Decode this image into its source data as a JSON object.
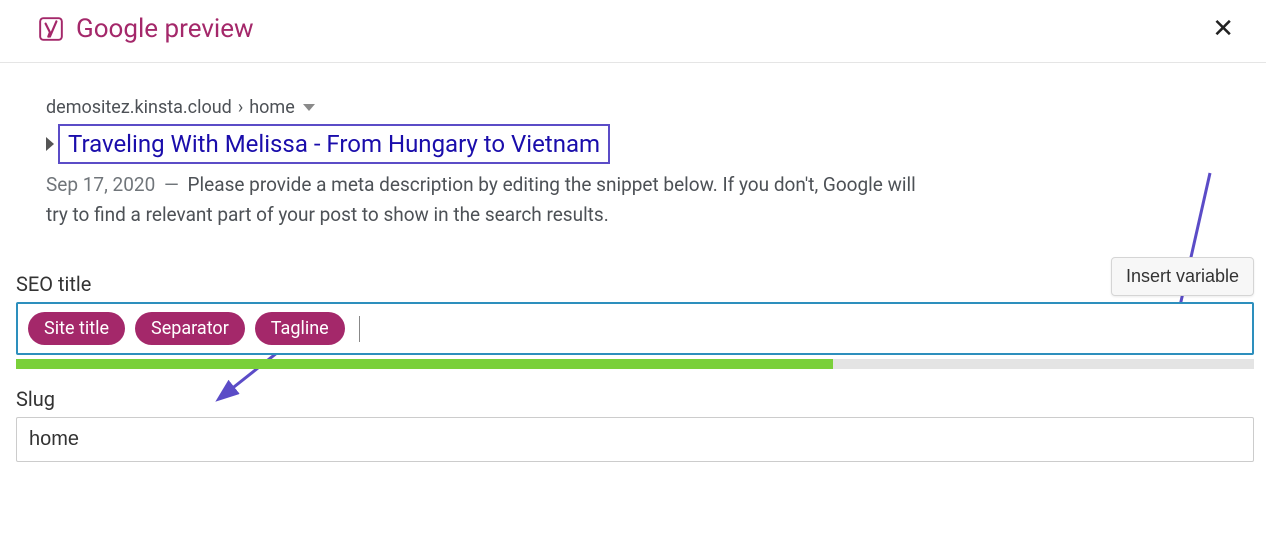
{
  "header": {
    "title": "Google preview"
  },
  "preview": {
    "domain": "demositez.kinsta.cloud",
    "path": "home",
    "title": "Traveling With Melissa - From Hungary to Vietnam",
    "date": "Sep 17, 2020",
    "description": "Please provide a meta description by editing the snippet below. If you don't, Google will try to find a relevant part of your post to show in the search results."
  },
  "seo_title": {
    "label": "SEO title",
    "insert_button": "Insert variable",
    "pills": [
      "Site title",
      "Separator",
      "Tagline"
    ],
    "progress_percent": 66
  },
  "slug": {
    "label": "Slug",
    "value": "home"
  }
}
